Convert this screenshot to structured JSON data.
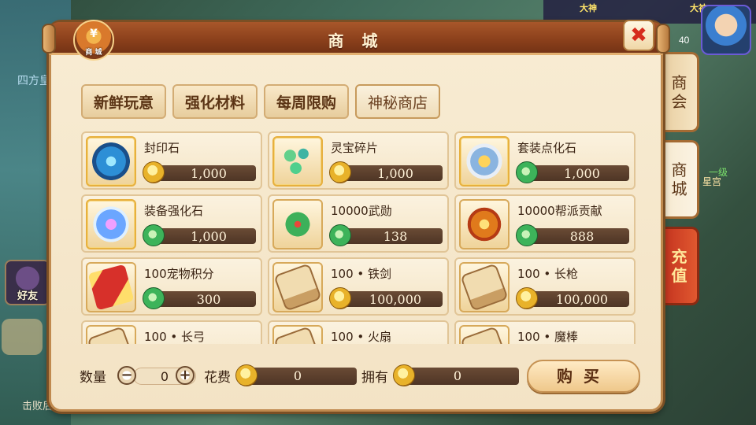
{
  "background": {
    "water_text": "四方皇",
    "top_names": [
      "大神",
      "大神"
    ],
    "avatar_level": "40",
    "friend_label": "好友",
    "bottom_text": "击败后背",
    "right_green": "一级",
    "right_text": "星宫"
  },
  "window": {
    "title": "商 城",
    "logo_symbol": "¥",
    "logo_label": "商 城",
    "close_glyph": "✖"
  },
  "tabs": [
    {
      "label": "新鲜玩意",
      "active": false
    },
    {
      "label": "强化材料",
      "active": false
    },
    {
      "label": "每周限购",
      "active": false
    },
    {
      "label": "神秘商店",
      "active": true
    }
  ],
  "side_tabs": [
    {
      "label": "商会"
    },
    {
      "label": "商城"
    },
    {
      "label": "充值"
    }
  ],
  "items": [
    {
      "name": "封印石",
      "icon": "seal-stone-icon",
      "currency": "gold",
      "price": "1,000"
    },
    {
      "name": "灵宝碎片",
      "icon": "treasure-fragment-icon",
      "currency": "gold",
      "price": "1,000"
    },
    {
      "name": "套装点化石",
      "icon": "suit-stone-icon",
      "currency": "jade",
      "price": "1,000"
    },
    {
      "name": "装备强化石",
      "icon": "enhance-stone-icon",
      "currency": "jade",
      "price": "1,000"
    },
    {
      "name": "10000武勋",
      "icon": "merit-token-icon",
      "currency": "jade",
      "price": "138"
    },
    {
      "name": "10000帮派贡献",
      "icon": "guild-token-icon",
      "currency": "jade",
      "price": "888"
    },
    {
      "name": "100宠物积分",
      "icon": "pet-card-icon",
      "currency": "jade",
      "price": "300"
    },
    {
      "name": "100 • 铁剑",
      "icon": "scroll-icon",
      "currency": "gold",
      "price": "100,000"
    },
    {
      "name": "100 • 长枪",
      "icon": "scroll-icon",
      "currency": "gold",
      "price": "100,000"
    },
    {
      "name": "100 • 长弓",
      "icon": "scroll-icon",
      "currency": "gold",
      "price": ""
    },
    {
      "name": "100 • 火扇",
      "icon": "scroll-icon",
      "currency": "gold",
      "price": ""
    },
    {
      "name": "100 • 魔棒",
      "icon": "scroll-icon",
      "currency": "gold",
      "price": ""
    }
  ],
  "footer": {
    "qty_label": "数量",
    "qty_value": "0",
    "minus": "−",
    "plus": "+",
    "cost_label": "花费",
    "cost_value": "0",
    "own_label": "拥有",
    "own_value": "0",
    "buy_label": "购买"
  }
}
